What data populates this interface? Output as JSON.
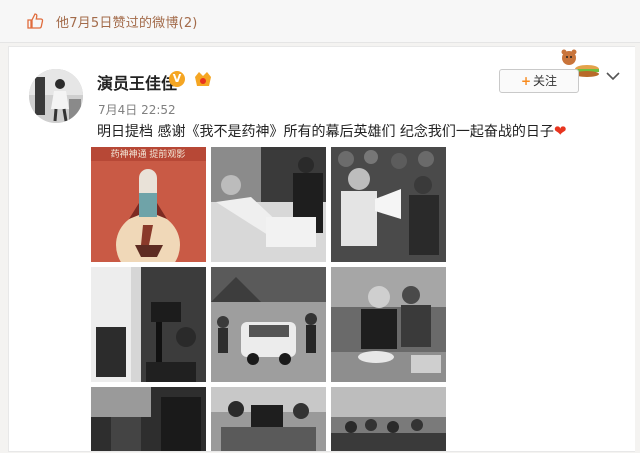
{
  "topbar": {
    "text": "他7月5日赞过的微博(2)",
    "icon": "thumbs-up-icon"
  },
  "post": {
    "username": "演员王佳佳",
    "verified_badge": "V",
    "time": "7月4日 22:52",
    "follow_label": "+关注",
    "follow_plus": "+",
    "follow_text": "关注",
    "content": "明日提档 感谢《我不是药神》所有的幕后英雄们 纪念我们一起奋战的日子",
    "poster_text": "药神神通 提前观影"
  },
  "colors": {
    "accent": "#f78a1e",
    "link_brown": "#a36b4a",
    "heart": "#e8351f",
    "badge": "#f5a623"
  }
}
